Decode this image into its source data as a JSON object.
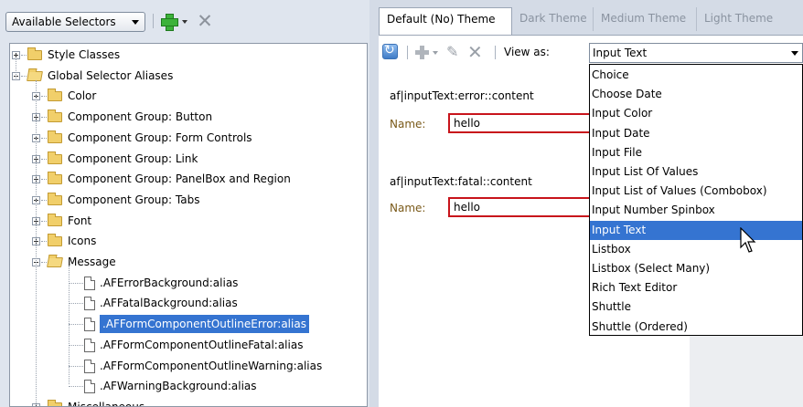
{
  "left_toolbar": {
    "selector_dropdown": "Available Selectors",
    "add_icon": "plus-icon",
    "delete_icon": "x-icon"
  },
  "tree": {
    "items": [
      {
        "label": "Style Classes",
        "level": 0,
        "expanded": false,
        "type": "folder"
      },
      {
        "label": "Global Selector Aliases",
        "level": 0,
        "expanded": true,
        "type": "folder"
      },
      {
        "label": "Color",
        "level": 1,
        "expanded": false,
        "type": "folder"
      },
      {
        "label": "Component Group: Button",
        "level": 1,
        "expanded": false,
        "type": "folder"
      },
      {
        "label": "Component Group: Form Controls",
        "level": 1,
        "expanded": false,
        "type": "folder"
      },
      {
        "label": "Component Group: Link",
        "level": 1,
        "expanded": false,
        "type": "folder"
      },
      {
        "label": "Component Group: PanelBox and Region",
        "level": 1,
        "expanded": false,
        "type": "folder"
      },
      {
        "label": "Component Group: Tabs",
        "level": 1,
        "expanded": false,
        "type": "folder"
      },
      {
        "label": "Font",
        "level": 1,
        "expanded": false,
        "type": "folder"
      },
      {
        "label": "Icons",
        "level": 1,
        "expanded": false,
        "type": "folder"
      },
      {
        "label": "Message",
        "level": 1,
        "expanded": true,
        "type": "folder"
      },
      {
        "label": ".AFErrorBackground:alias",
        "level": 2,
        "type": "file"
      },
      {
        "label": ".AFFatalBackground:alias",
        "level": 2,
        "type": "file"
      },
      {
        "label": ".AFFormComponentOutlineError:alias",
        "level": 2,
        "type": "file",
        "selected": true
      },
      {
        "label": ".AFFormComponentOutlineFatal:alias",
        "level": 2,
        "type": "file"
      },
      {
        "label": ".AFFormComponentOutlineWarning:alias",
        "level": 2,
        "type": "file"
      },
      {
        "label": ".AFWarningBackground:alias",
        "level": 2,
        "type": "file"
      },
      {
        "label": "Miscellaneous",
        "level": 1,
        "expanded": false,
        "type": "folder"
      }
    ]
  },
  "tabs": [
    {
      "label": "Default (No) Theme",
      "active": true
    },
    {
      "label": "Dark Theme",
      "active": false
    },
    {
      "label": "Medium Theme",
      "active": false
    },
    {
      "label": "Light Theme",
      "active": false
    }
  ],
  "right_toolbar": {
    "view_as_label": "View as:",
    "view_as_value": "Input Text"
  },
  "preview": {
    "blocks": [
      {
        "selector": "af|inputText:error::content",
        "name_label": "Name:",
        "value": "hello"
      },
      {
        "selector": "af|inputText:fatal::content",
        "name_label": "Name:",
        "value": "hello"
      }
    ]
  },
  "dropdown": {
    "options": [
      "Choice",
      "Choose Date",
      "Input Color",
      "Input Date",
      "Input File",
      "Input List Of Values",
      "Input List of Values (Combobox)",
      "Input Number Spinbox",
      "Input Text",
      "Listbox",
      "Listbox (Select Many)",
      "Rich Text Editor",
      "Shuttle",
      "Shuttle (Ordered)"
    ],
    "highlighted": "Input Text"
  },
  "colors": {
    "selection": "#3574d1",
    "error_outline": "#c8141b",
    "panel_bg": "#dfe5ee"
  }
}
